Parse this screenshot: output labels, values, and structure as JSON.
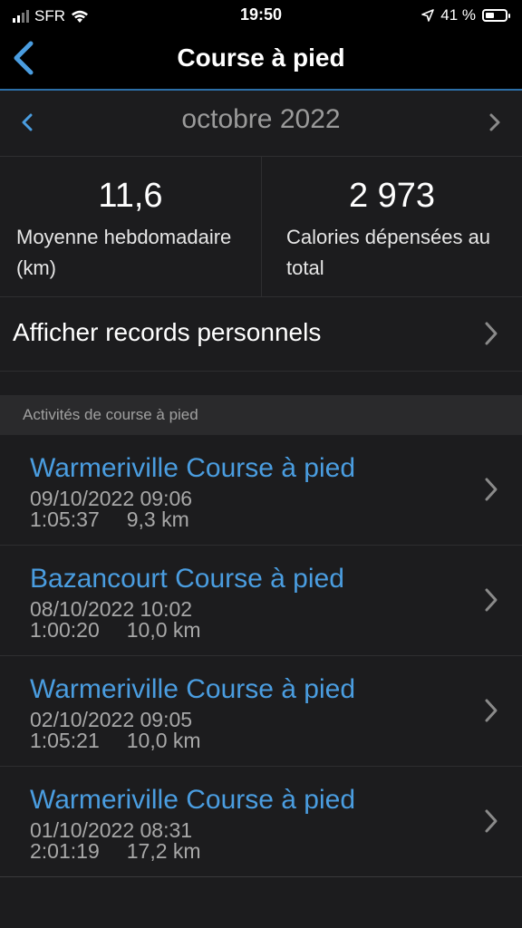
{
  "status_bar": {
    "carrier": "SFR",
    "time": "19:50",
    "battery": "41 %"
  },
  "nav": {
    "title": "Course à pied"
  },
  "month": {
    "label": "octobre 2022"
  },
  "stats": {
    "weekly_avg_value": "11,6",
    "weekly_avg_label": "Moyenne hebdomadaire (km)",
    "calories_value": "2 973",
    "calories_label": "Calories dépensées au total"
  },
  "records": {
    "label": "Afficher records personnels"
  },
  "section": {
    "title": "Activités de course à pied"
  },
  "activities": [
    {
      "title": "Warmeriville Course à pied",
      "date": "09/10/2022 09:06",
      "duration": "1:05:37",
      "distance": "9,3 km"
    },
    {
      "title": "Bazancourt Course à pied",
      "date": "08/10/2022 10:02",
      "duration": "1:00:20",
      "distance": "10,0 km"
    },
    {
      "title": "Warmeriville Course à pied",
      "date": "02/10/2022 09:05",
      "duration": "1:05:21",
      "distance": "10,0 km"
    },
    {
      "title": "Warmeriville Course à pied",
      "date": "01/10/2022 08:31",
      "duration": "2:01:19",
      "distance": "17,2 km"
    }
  ],
  "colors": {
    "accent": "#4a9de0",
    "background": "#1c1c1e"
  }
}
